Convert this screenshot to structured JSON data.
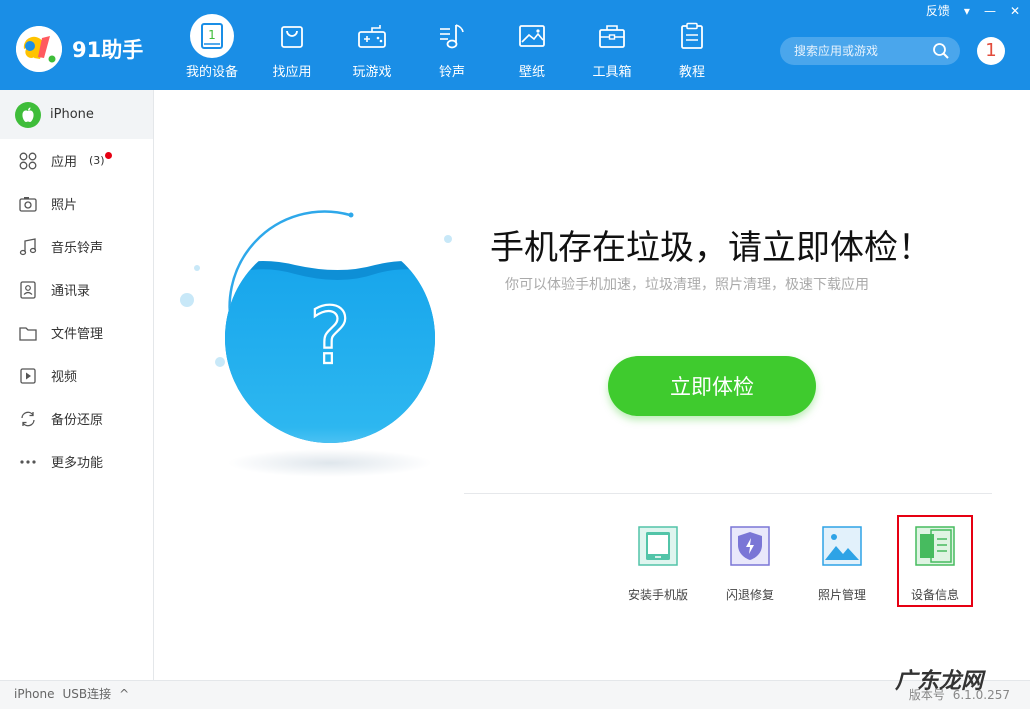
{
  "app": {
    "name": "91助手"
  },
  "nav": [
    {
      "label": "我的设备",
      "icon": "tablet-icon"
    },
    {
      "label": "找应用",
      "icon": "shopping-bag-icon"
    },
    {
      "label": "玩游戏",
      "icon": "gamepad-icon"
    },
    {
      "label": "铃声",
      "icon": "music-note-icon"
    },
    {
      "label": "壁纸",
      "icon": "picture-icon"
    },
    {
      "label": "工具箱",
      "icon": "toolbox-icon"
    },
    {
      "label": "教程",
      "icon": "clipboard-icon"
    }
  ],
  "topbar": {
    "feedback": "反馈",
    "menu": "▾",
    "minimize": "—",
    "close": "✕"
  },
  "search": {
    "placeholder": "搜索应用或游戏"
  },
  "messages": {
    "count": "1"
  },
  "sidebar": {
    "device": "iPhone",
    "items": [
      {
        "label": "应用",
        "count": "(3)"
      },
      {
        "label": "照片"
      },
      {
        "label": "音乐铃声"
      },
      {
        "label": "通讯录"
      },
      {
        "label": "文件管理"
      },
      {
        "label": "视频"
      },
      {
        "label": "备份还原"
      },
      {
        "label": "更多功能"
      }
    ]
  },
  "main": {
    "headline": "手机存在垃圾，请立即体检！",
    "subline": "你可以体验手机加速，垃圾清理，照片清理，极速下载应用",
    "check_button": "立即体检",
    "circle_symbol": "?",
    "tools": [
      {
        "label": "安装手机版",
        "icon": "install-phone-icon"
      },
      {
        "label": "闪退修复",
        "icon": "crash-repair-icon"
      },
      {
        "label": "照片管理",
        "icon": "photo-manage-icon"
      },
      {
        "label": "设备信息",
        "icon": "device-info-icon"
      }
    ]
  },
  "status": {
    "device": "iPhone",
    "connection": "USB连接",
    "caret": "^",
    "version_label": "版本号",
    "version": "6.1.0.257"
  },
  "watermark": "广东龙网",
  "colors": {
    "brand_blue": "#1a8ee6",
    "green": "#3fcb2e",
    "alert_red": "#e60012"
  }
}
